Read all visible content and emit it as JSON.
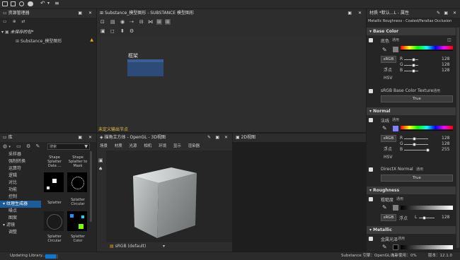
{
  "top_toolbar": {
    "icons": [
      "folder-open-icon",
      "save-icon",
      "share-icon",
      "undo-icon",
      "redo-icon",
      "menu-icon"
    ]
  },
  "explorer": {
    "title": "资源管理器",
    "unsaved_pkg": "未保存的包*",
    "graph_item": "Substance_模型图形"
  },
  "graph": {
    "title": "Substance_模型图形 - SUBSTANCE 模型图形",
    "frame_label": "框架",
    "undefined_output": "未定义输出节点"
  },
  "library": {
    "title": "库",
    "search_placeholder": "搜索",
    "categories": [
      "采样器",
      "强制转换",
      "运算符",
      "逻辑",
      "对比",
      "功能",
      "控制",
      "纹理生成器",
      "噪点",
      "图案",
      "滤镜",
      "调整"
    ],
    "items": [
      "Shape Splatter Data ...",
      "Shape Splatter to Mask",
      "Splatter",
      "Splatter Circular",
      "Splatter Circular",
      "Splatter Color"
    ]
  },
  "view3d": {
    "title": "描角立方体 - OpenGL - 3D视图",
    "menu": [
      "场景",
      "材质",
      "光源",
      "相机",
      "环境",
      "显示",
      "渲染器"
    ],
    "color_mode": "sRGB (default)"
  },
  "view2d": {
    "title": "2D视图"
  },
  "properties": {
    "title": "材质 *默认...L - 属性",
    "subtitle": "Metallic Roughness - Coated/Parallax Occlusion",
    "base_color": {
      "section": "Base Color",
      "label": "底色",
      "use": "通用",
      "srgb": "sRGB",
      "float": "浮点",
      "hsv": "HSV",
      "r_label": "R",
      "g_label": "G",
      "b_label": "B",
      "r": "128",
      "g": "128",
      "b": "128",
      "tex_label": "sRGB Base Color Texture",
      "tex_use": "通用",
      "tex_value": "True"
    },
    "normal": {
      "section": "Normal",
      "label": "法线",
      "use": "通用",
      "srgb": "sRGB",
      "float": "浮点",
      "hsv": "HSV",
      "r_label": "R",
      "g_label": "G",
      "b_label": "B",
      "r": "128",
      "g": "128",
      "b": "255",
      "directx_label": "DirectX Normal",
      "directx_use": "通用",
      "directx_value": "True"
    },
    "roughness": {
      "section": "Roughness",
      "label": "粗糙度",
      "use": "通用",
      "srgb": "sRGB",
      "float": "浮点",
      "l_label": "L",
      "l": "128"
    },
    "metallic": {
      "section": "Metallic",
      "label": "金属光泽",
      "use": "通用"
    },
    "colors": {
      "accent": "#0a78d4",
      "swatch_base": "#808080",
      "swatch_normal": "#8080ff"
    }
  },
  "status": {
    "loading": "Updating Library...",
    "engine": "Substance 引擎：OpenGL 3.x",
    "memory_label": "内存使用：",
    "memory_value": "0%",
    "version": "版本：12.1.0"
  }
}
